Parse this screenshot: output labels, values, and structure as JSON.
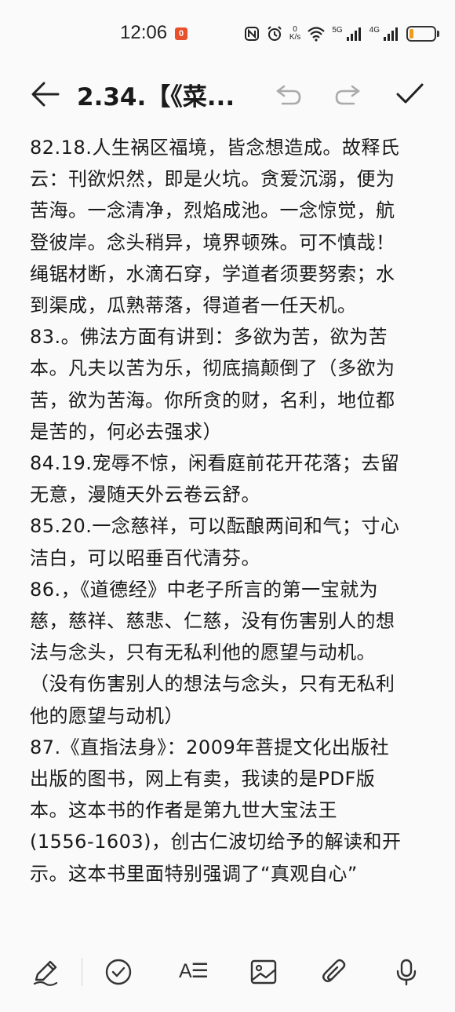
{
  "status_bar": {
    "time": "12:06",
    "notif_badge": "0",
    "net_speed_value": "0",
    "net_speed_unit": "K/s",
    "network_1": "5G",
    "network_2": "4G",
    "battery_level": 0.15,
    "battery_color": "#f29a1c"
  },
  "header": {
    "title": "2.34.【《菜...",
    "back_icon": "arrow-left-icon",
    "undo_icon": "undo-icon",
    "redo_icon": "redo-icon",
    "done_icon": "check-icon"
  },
  "note": {
    "lines": [
      "82.18.人生祸区福境，皆念想造成。故释氏",
      "云：刊欲炽然，即是火坑。贪爱沉溺，便为",
      "苦海。一念清净，烈焰成池。一念惊觉，航",
      "登彼岸。念头稍异，境界顿殊。可不慎哉！",
      "绳锯材断，水滴石穿，学道者须要努索；水",
      "到渠成，瓜熟蒂落，得道者一任天机。",
      "83.。佛法方面有讲到：多欲为苦，欲为苦",
      "本。凡夫以苦为乐，彻底搞颠倒了（多欲为",
      "苦，欲为苦海。你所贪的财，名利，地位都",
      "是苦的，何必去强求）",
      "84.19.宠辱不惊，闲看庭前花开花落；去留",
      "无意，漫随天外云卷云舒。",
      "85.20.一念慈祥，可以酝酿两间和气；寸心",
      "洁白，可以昭垂百代清芬。",
      "86.，《道德经》中老子所言的第一宝就为",
      "慈，慈祥、慈悲、仁慈，没有伤害别人的想",
      "法与念头，只有无私利他的愿望与动机。",
      "（没有伤害别人的想法与念头，只有无私利",
      "他的愿望与动机）",
      "87.《直指法身》：2009年菩提文化出版社",
      "出版的图书，网上有卖，我读的是PDF版",
      "本。这本书的作者是第九世大宝法王",
      "(1556-1603)，创古仁波切给予的解读和开",
      "示。这本书里面特别强调了“真观自心”"
    ]
  },
  "toolbar": {
    "pen_icon": "pen-icon",
    "checklist_icon": "checklist-icon",
    "text_format_label": "A☰",
    "image_icon": "image-icon",
    "attach_icon": "paperclip-icon",
    "mic_icon": "microphone-icon"
  }
}
